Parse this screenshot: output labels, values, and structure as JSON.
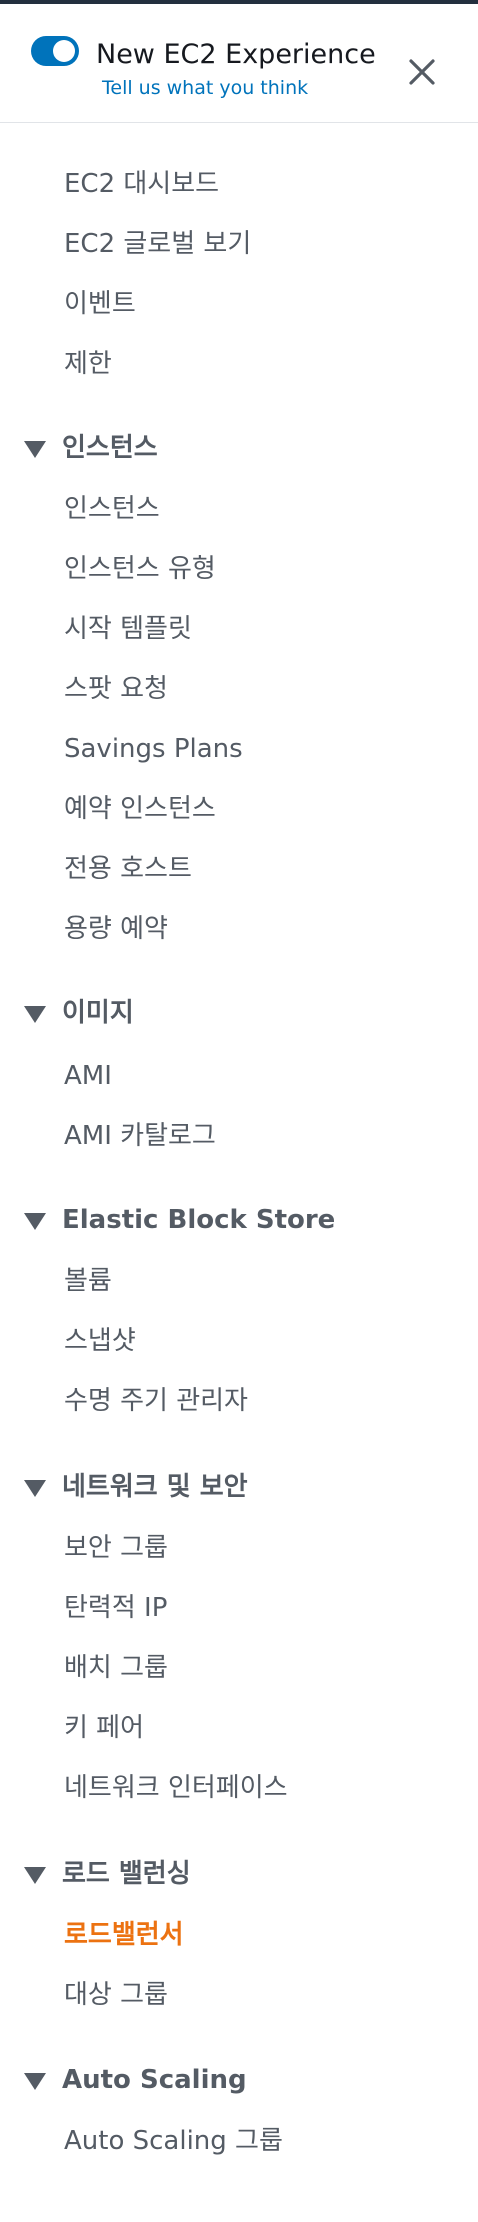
{
  "header": {
    "toggle_label": "New EC2 Experience",
    "feedback_link": "Tell us what you think",
    "toggle_on": true
  },
  "nav": {
    "top_items": [
      {
        "label": "EC2 대시보드"
      },
      {
        "label": "EC2 글로벌 보기"
      },
      {
        "label": "이벤트"
      },
      {
        "label": "제한"
      }
    ],
    "sections": [
      {
        "title": "인스턴스",
        "expanded": true,
        "items": [
          {
            "label": "인스턴스"
          },
          {
            "label": "인스턴스 유형"
          },
          {
            "label": "시작 템플릿"
          },
          {
            "label": "스팟 요청"
          },
          {
            "label": "Savings Plans"
          },
          {
            "label": "예약 인스턴스"
          },
          {
            "label": "전용 호스트"
          },
          {
            "label": "용량 예약"
          }
        ]
      },
      {
        "title": "이미지",
        "expanded": true,
        "items": [
          {
            "label": "AMI"
          },
          {
            "label": "AMI 카탈로그"
          }
        ]
      },
      {
        "title": "Elastic Block Store",
        "expanded": true,
        "items": [
          {
            "label": "볼륨"
          },
          {
            "label": "스냅샷"
          },
          {
            "label": "수명 주기 관리자"
          }
        ]
      },
      {
        "title": "네트워크 및 보안",
        "expanded": true,
        "items": [
          {
            "label": "보안 그룹"
          },
          {
            "label": "탄력적 IP"
          },
          {
            "label": "배치 그룹"
          },
          {
            "label": "키 페어"
          },
          {
            "label": "네트워크 인터페이스"
          }
        ]
      },
      {
        "title": "로드 밸런싱",
        "expanded": true,
        "items": [
          {
            "label": "로드밸런서",
            "active": true
          },
          {
            "label": "대상 그룹"
          }
        ]
      },
      {
        "title": "Auto Scaling",
        "expanded": true,
        "items": [
          {
            "label": "Auto Scaling 그룹"
          }
        ]
      }
    ]
  },
  "colors": {
    "accent": "#0073bb",
    "active": "#ec7211",
    "text": "#545b64"
  },
  "icons": {
    "close": "close-icon",
    "caret": "caret-down-icon"
  }
}
